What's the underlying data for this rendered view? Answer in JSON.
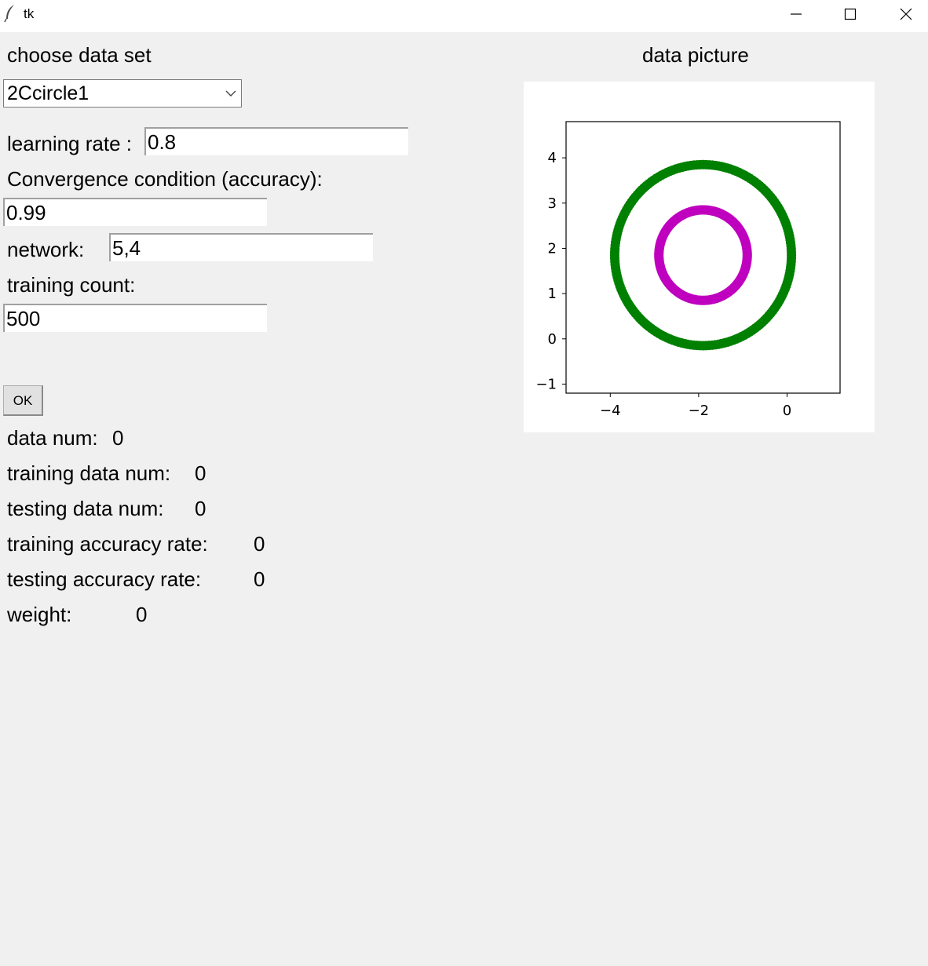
{
  "window": {
    "title": "tk"
  },
  "form": {
    "choose_label": "choose data set",
    "dataset_selected": "2Ccircle1",
    "lr_label": "learning rate :",
    "lr_value": "0.8",
    "conv_label": "Convergence condition (accuracy):",
    "conv_value": "0.99",
    "network_label": "network:",
    "network_value": "5,4",
    "count_label": "training count:",
    "count_value": "500",
    "ok_label": "OK"
  },
  "stats": {
    "data_num_label": "data num:",
    "data_num": "0",
    "train_num_label": "training data num:",
    "train_num": "0",
    "test_num_label": "testing data num:",
    "test_num": "0",
    "train_acc_label": "training accuracy rate:",
    "train_acc": "0",
    "test_acc_label": "testing accuracy rate:",
    "test_acc": "0",
    "weight_label": "weight:",
    "weight": "0"
  },
  "picture": {
    "title": "data picture"
  },
  "chart_data": {
    "type": "scatter",
    "title": "",
    "xlabel": "",
    "ylabel": "",
    "xlim": [
      -5.0,
      1.2
    ],
    "ylim": [
      -1.2,
      4.8
    ],
    "xticks": [
      "−4",
      "−2",
      "0"
    ],
    "xtick_values": [
      -4,
      -2,
      0
    ],
    "yticks": [
      "−1",
      "0",
      "1",
      "2",
      "3",
      "4"
    ],
    "ytick_values": [
      -1,
      0,
      1,
      2,
      3,
      4
    ],
    "series": [
      {
        "shape": "circle-ring",
        "center": [
          -1.9,
          1.85
        ],
        "radius": 2.0,
        "color": "#008000"
      },
      {
        "shape": "circle-ring",
        "center": [
          -1.9,
          1.85
        ],
        "radius": 1.0,
        "color": "#bf00bf"
      }
    ]
  }
}
